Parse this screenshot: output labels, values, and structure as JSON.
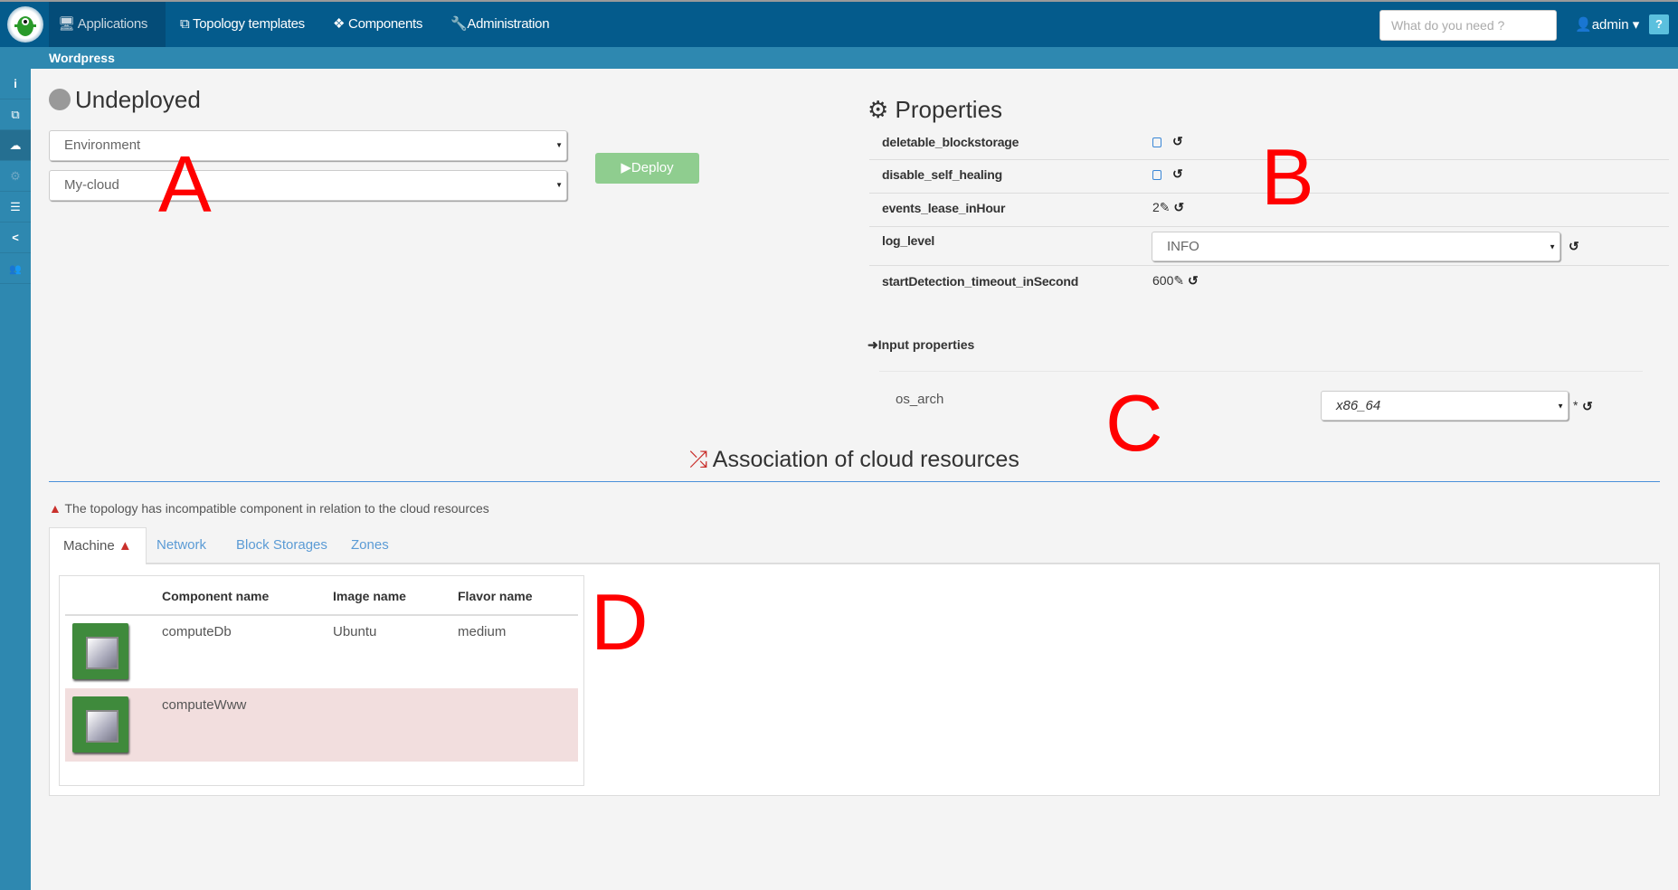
{
  "nav": {
    "items": [
      {
        "label": "Applications",
        "icon": "desktop-icon",
        "active": true
      },
      {
        "label": "Topology templates",
        "icon": "sitemap-icon"
      },
      {
        "label": "Components",
        "icon": "cubes-icon"
      },
      {
        "label": "Administration",
        "icon": "wrench-icon"
      }
    ],
    "search_placeholder": "What do you need ?",
    "user": "admin",
    "help": "?"
  },
  "breadcrumb": "Wordpress",
  "sidebar": {
    "items": [
      {
        "icon": "info-icon",
        "glyph": "i"
      },
      {
        "icon": "sitemap-icon",
        "glyph": "⧉"
      },
      {
        "icon": "cloud-upload-icon",
        "glyph": "☁",
        "active": true
      },
      {
        "icon": "gears-icon",
        "glyph": "⚙",
        "dim": true
      },
      {
        "icon": "server-icon",
        "glyph": "☰"
      },
      {
        "icon": "share-icon",
        "glyph": "<"
      },
      {
        "icon": "users-icon",
        "glyph": "👥"
      }
    ]
  },
  "deploy": {
    "status": "Undeployed",
    "environment": "Environment",
    "location": "My-cloud",
    "deploy_label": "Deploy"
  },
  "properties": {
    "title": "Properties",
    "rows": [
      {
        "name": "deletable_blockstorage",
        "type": "checkbox",
        "value": ""
      },
      {
        "name": "disable_self_healing",
        "type": "checkbox",
        "value": ""
      },
      {
        "name": "events_lease_inHour",
        "type": "text",
        "value": "2"
      },
      {
        "name": "log_level",
        "type": "select",
        "value": "INFO"
      },
      {
        "name": "startDetection_timeout_inSecond",
        "type": "text",
        "value": "600"
      }
    ]
  },
  "input_properties": {
    "title": "Input properties",
    "rows": [
      {
        "name": "os_arch",
        "value": "x86_64",
        "required": "*"
      }
    ]
  },
  "association": {
    "title": "Association of cloud resources",
    "warning": "The topology has incompatible component in relation to the cloud resources",
    "tabs": [
      "Machine",
      "Network",
      "Block Storages",
      "Zones"
    ],
    "columns": [
      "Component name",
      "Image name",
      "Flavor name"
    ],
    "rows": [
      {
        "component": "computeDb",
        "image": "Ubuntu",
        "flavor": "medium",
        "error": false
      },
      {
        "component": "computeWww",
        "image": "",
        "flavor": "",
        "error": true
      }
    ]
  },
  "annotations": {
    "a": "A",
    "b": "B",
    "c": "C",
    "d": "D"
  },
  "colors": {
    "navbar": "#045b8c",
    "subbar": "#2e88b0",
    "deploy": "#8fcd8f",
    "error_row": "#f2dede",
    "warning": "#c9302c",
    "tab_link": "#5b9bd5"
  }
}
